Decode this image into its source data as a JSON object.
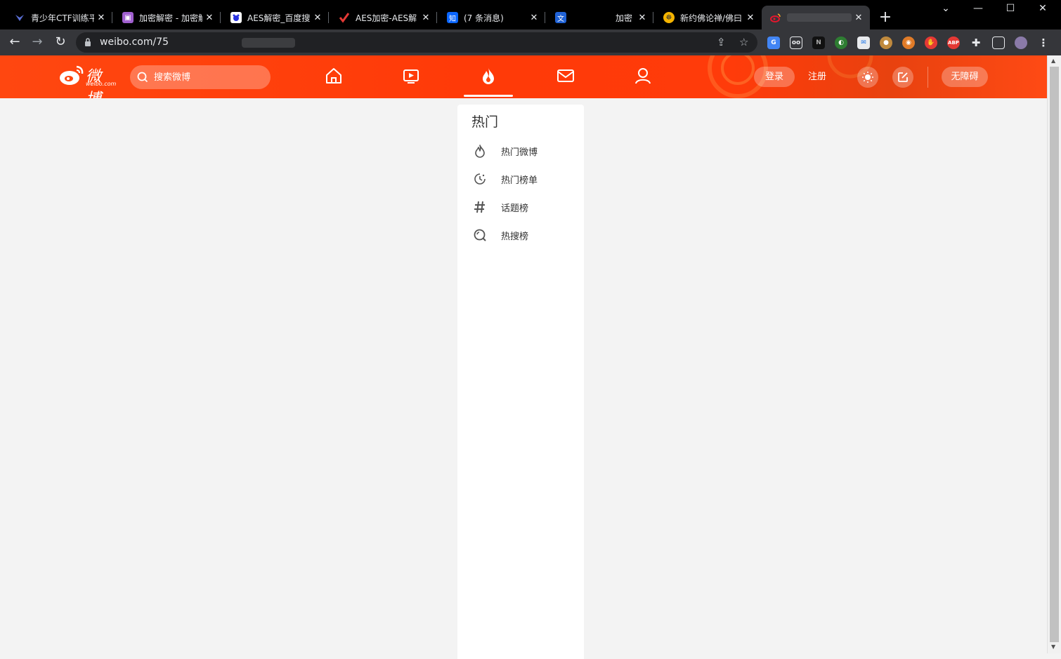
{
  "browser": {
    "tabs": [
      {
        "title": "青少年CTF训练平",
        "favicon": "ctf-icon",
        "color": "#5a6fd6"
      },
      {
        "title": "加密解密 - 加密解",
        "favicon": "crypt-icon",
        "color": "#a05fcf"
      },
      {
        "title": "AES解密_百度搜",
        "favicon": "baidu-icon",
        "color": "#2932e1"
      },
      {
        "title": "AES加密-AES解",
        "favicon": "check-icon",
        "color": "#e53935"
      },
      {
        "title": "(7 条消息)",
        "favicon": "zhihu-icon",
        "color": "#0a66ff"
      },
      {
        "title": "加密",
        "favicon": "app-icon",
        "color": "#2062d6"
      },
      {
        "title": "新约佛论禅/佛曰",
        "favicon": "buddha-icon",
        "color": "#f5b400"
      },
      {
        "title": "",
        "favicon": "weibo-icon",
        "color": "#e6162d"
      }
    ],
    "url": "weibo.com/75",
    "window_controls": {
      "dropdown": "⌄",
      "minimize": "—",
      "maximize": "☐",
      "close": "✕"
    }
  },
  "weibo": {
    "logo_text": "微博",
    "logo_domain": "weibo.com",
    "search_placeholder": "搜索微博",
    "login": "登录",
    "register": "注册",
    "accessibility": "无障碍"
  },
  "sidebar": {
    "title": "热门",
    "items": [
      {
        "label": "热门微博",
        "icon": "flame-icon"
      },
      {
        "label": "热门榜单",
        "icon": "clock-icon"
      },
      {
        "label": "话题榜",
        "icon": "hashtag-icon"
      },
      {
        "label": "热搜榜",
        "icon": "search-rank-icon"
      }
    ]
  },
  "colors": {
    "weibo_orange": "#ff4710",
    "browser_dark": "#35363a",
    "page_bg": "#f3f3f3"
  }
}
